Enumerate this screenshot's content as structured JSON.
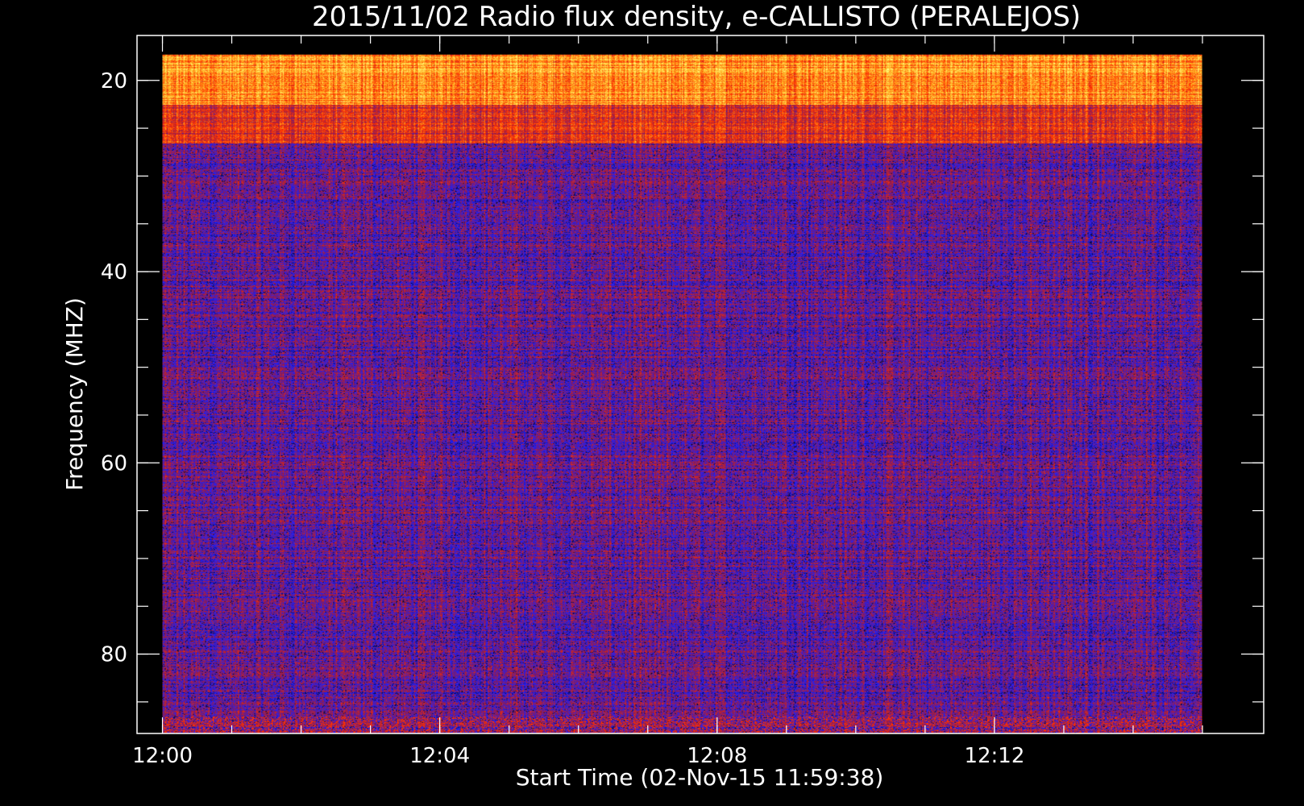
{
  "chart_data": {
    "type": "heatmap",
    "title": "2015/11/02  Radio flux density, e-CALLISTO (PERALEJOS)",
    "xlabel": "Start Time (02-Nov-15 11:59:38)",
    "ylabel": "Frequency (MHZ)",
    "x_range": [
      "11:59:38",
      "12:15:53"
    ],
    "x_major_ticks": [
      "12:00",
      "12:04",
      "12:08",
      "12:12"
    ],
    "y_range_mhz": [
      15.3,
      88.3
    ],
    "y_inverted": true,
    "y_major_ticks": [
      20,
      40,
      60,
      80
    ],
    "y_minor_tick_step": 5,
    "data_start": "12:00",
    "data_end": "12:15",
    "data_freq_range_mhz": [
      17.3,
      88.3
    ],
    "colormap": [
      "#000000",
      "#2020ff",
      "#8a1a55",
      "#ff3000",
      "#ffb020",
      "#ffff80"
    ],
    "features": [
      {
        "freq_range_mhz": [
          17.3,
          22.5
        ],
        "description": "intense interference band",
        "level": 0.75
      },
      {
        "freq_range_mhz": [
          22.5,
          26.5
        ],
        "description": "orange/red interference band",
        "level": 0.55
      },
      {
        "freq_range_mhz": [
          26.5,
          88.3
        ],
        "description": "background",
        "level": 0.32
      }
    ]
  }
}
